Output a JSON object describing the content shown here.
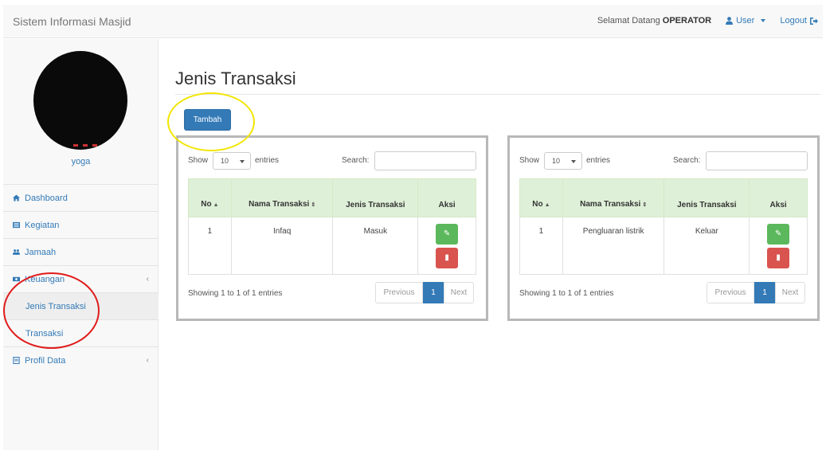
{
  "app": {
    "brand": "Sistem Informasi Masjid"
  },
  "navbar": {
    "greeting": "Selamat Datang",
    "role": "OPERATOR",
    "user_label": "User",
    "logout_label": "Logout"
  },
  "sidebar": {
    "username": "yoga",
    "items": [
      {
        "label": "Dashboard"
      },
      {
        "label": "Kegiatan"
      },
      {
        "label": "Jamaah"
      },
      {
        "label": "Keuangan"
      }
    ],
    "sub_items": [
      {
        "label": "Jenis Transaksi"
      },
      {
        "label": "Transaksi"
      }
    ],
    "profil": {
      "label": "Profil Data"
    }
  },
  "main": {
    "title": "Jenis Transaksi",
    "add_button": "Tambah"
  },
  "tables": [
    {
      "show_label": "Show",
      "entries_value": "10",
      "entries_label": "entries",
      "search_label": "Search:",
      "columns": [
        "No",
        "Nama Transaksi",
        "Jenis Transaksi",
        "Aksi"
      ],
      "rows": [
        {
          "no": "1",
          "nama": "Infaq",
          "jenis": "Masuk"
        }
      ],
      "info": "Showing 1 to 1 of 1 entries",
      "prev": "Previous",
      "page": "1",
      "next": "Next"
    },
    {
      "show_label": "Show",
      "entries_value": "10",
      "entries_label": "entries",
      "search_label": "Search:",
      "columns": [
        "No",
        "Nama Transaksi",
        "Jenis Transaksi",
        "Aksi"
      ],
      "rows": [
        {
          "no": "1",
          "nama": "Pengluaran listrik",
          "jenis": "Keluar"
        }
      ],
      "info": "Showing 1 to 1 of 1 entries",
      "prev": "Previous",
      "page": "1",
      "next": "Next"
    }
  ],
  "colors": {
    "primary": "#337ab7",
    "success": "#5cb85c",
    "danger": "#d9534f",
    "header_green": "#dff0d8",
    "annotation_yellow": "#f2e600",
    "annotation_red": "#e01b1b"
  }
}
